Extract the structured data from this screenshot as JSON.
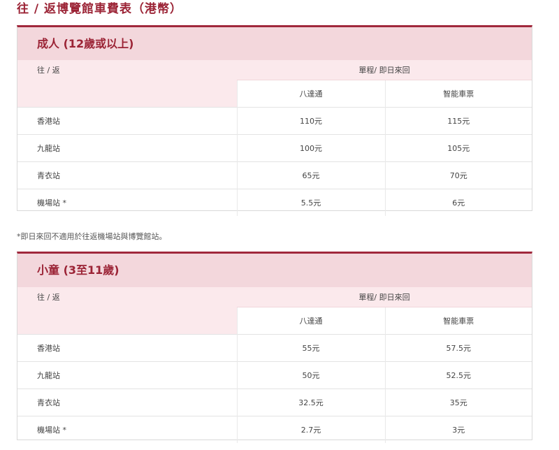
{
  "page": {
    "title": "往 / 返博覽館車費表（港幣）"
  },
  "adult": {
    "header": "成人 (12歲或以上)",
    "route_header": "往 / 返",
    "trip_header": "單程/ 即日來回",
    "col_octopus": "八達通",
    "col_smart_ticket": "智能車票",
    "rows": [
      {
        "station": "香港站",
        "octopus": "110元",
        "smart": "115元"
      },
      {
        "station": "九龍站",
        "octopus": "100元",
        "smart": "105元"
      },
      {
        "station": "青衣站",
        "octopus": "65元",
        "smart": "70元"
      },
      {
        "station": "機場站 *",
        "octopus": "5.5元",
        "smart": "6元"
      }
    ]
  },
  "note": "*即日來回不適用於往返機場站與博覽館站。",
  "child": {
    "header": "小童 (3至11歲)",
    "route_header": "往 / 返",
    "trip_header": "單程/ 即日來回",
    "col_octopus": "八達通",
    "col_smart_ticket": "智能車票",
    "rows": [
      {
        "station": "香港站",
        "octopus": "55元",
        "smart": "57.5元"
      },
      {
        "station": "九龍站",
        "octopus": "50元",
        "smart": "52.5元"
      },
      {
        "station": "青衣站",
        "octopus": "32.5元",
        "smart": "35元"
      },
      {
        "station": "機場站 *",
        "octopus": "2.7元",
        "smart": "3元"
      }
    ]
  }
}
